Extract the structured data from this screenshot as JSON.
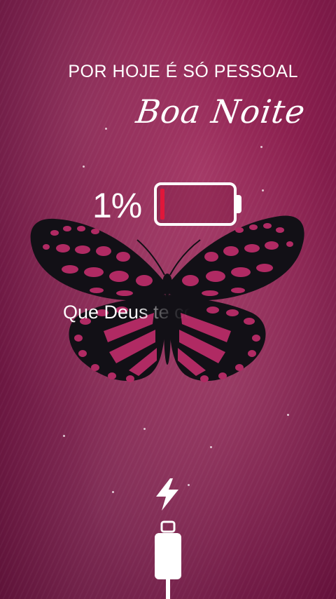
{
  "screen": {
    "headline": "POR HOJE É SÓ PESSOAL",
    "script_title": "Boa Noite",
    "subtitle": "Que Deus te cob"
  },
  "battery": {
    "percent_text": "1%",
    "level_percent": 1,
    "fill_color": "#e0173a",
    "outline_color": "#ffffff"
  },
  "icons": {
    "charging": "lightning-bolt-icon",
    "cable": "charging-cable-icon",
    "butterfly": "butterfly-illustration"
  },
  "colors": {
    "background": "#8a1f4e",
    "butterfly_wing": "#121016",
    "butterfly_spots": "#b02a63",
    "text": "#ffffff"
  }
}
